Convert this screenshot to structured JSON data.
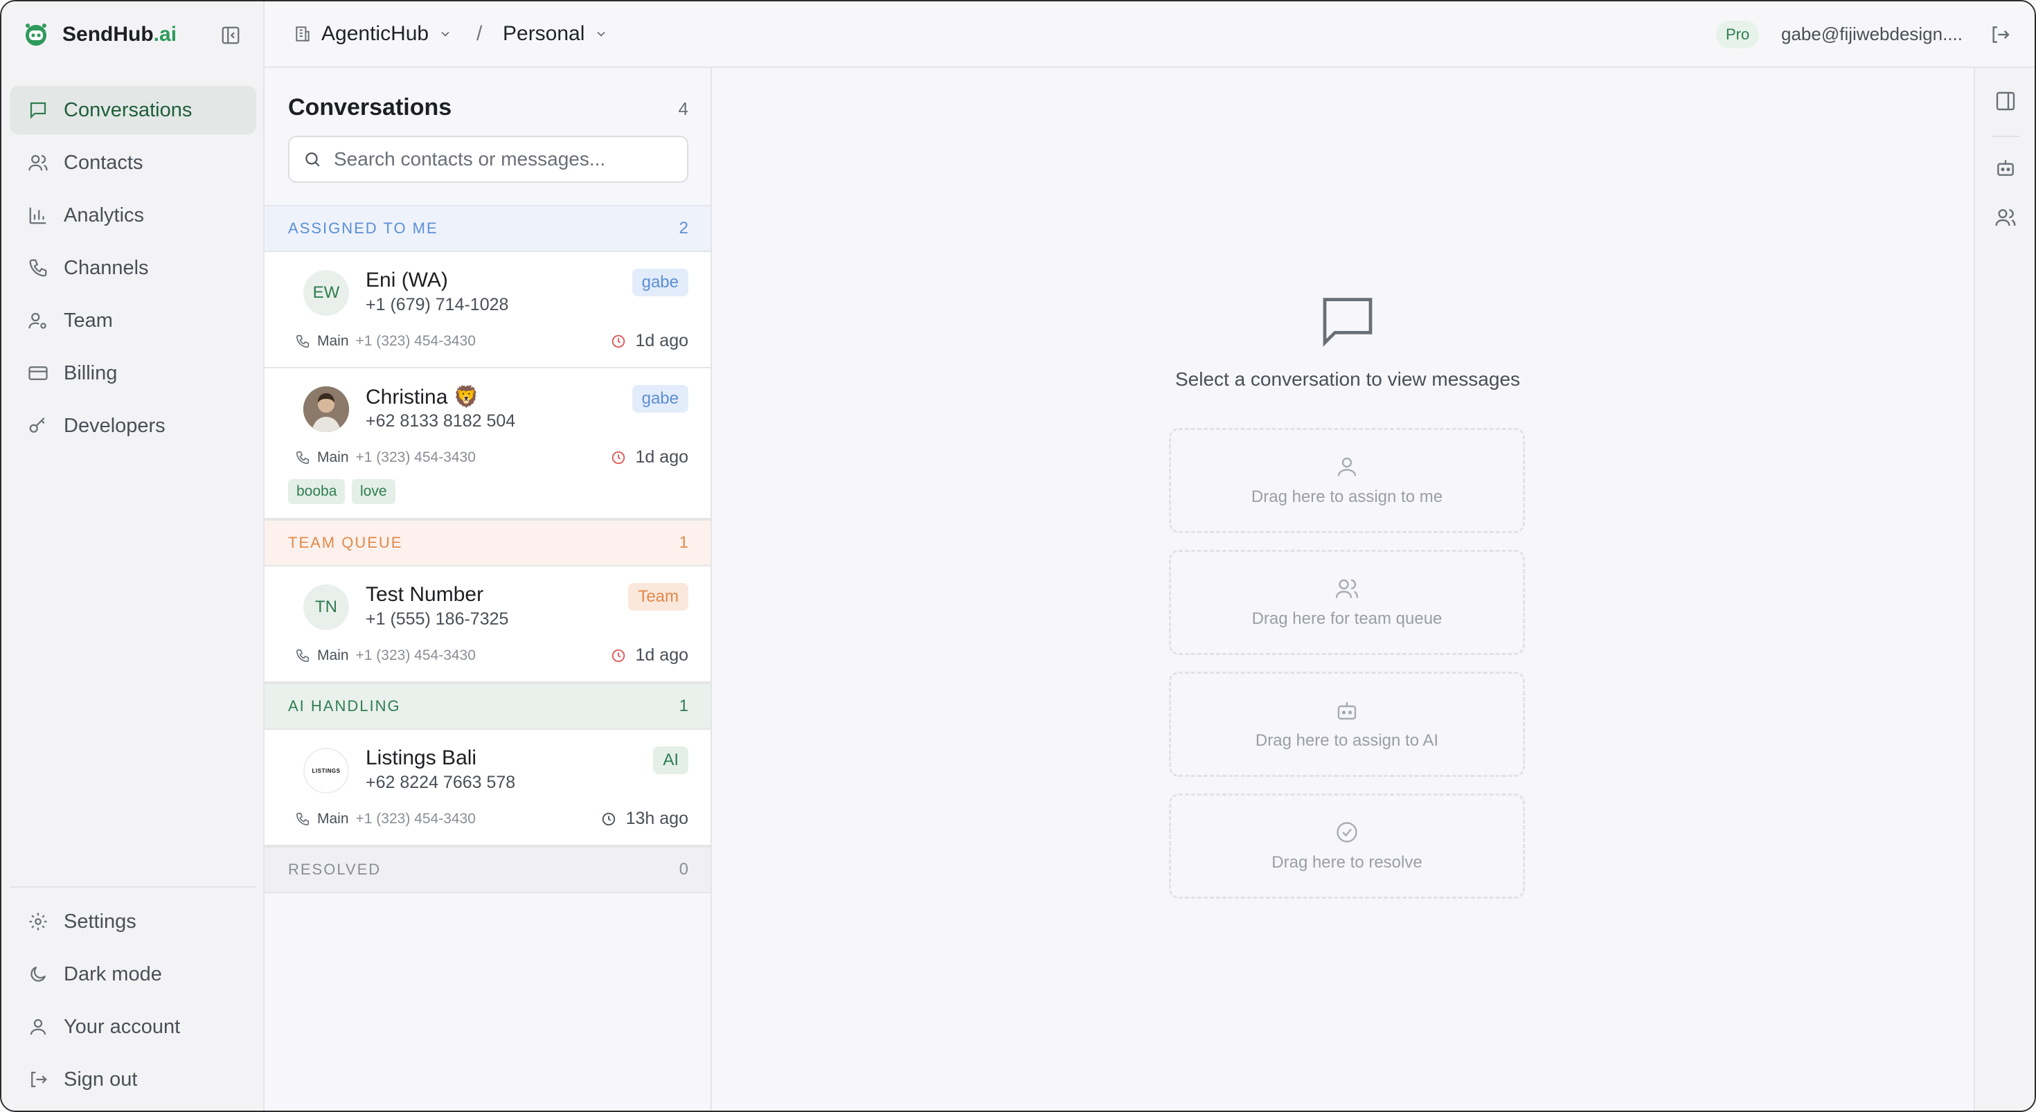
{
  "brand": {
    "name": "SendHub",
    "suffix": ".ai"
  },
  "nav": {
    "items": [
      {
        "label": "Conversations",
        "icon": "chat-icon",
        "active": true
      },
      {
        "label": "Contacts",
        "icon": "users-icon"
      },
      {
        "label": "Analytics",
        "icon": "bar-chart-icon"
      },
      {
        "label": "Channels",
        "icon": "phone-icon"
      },
      {
        "label": "Team",
        "icon": "user-gear-icon"
      },
      {
        "label": "Billing",
        "icon": "credit-card-icon"
      },
      {
        "label": "Developers",
        "icon": "key-icon"
      }
    ],
    "bottom": [
      {
        "label": "Settings",
        "icon": "gear-icon"
      },
      {
        "label": "Dark mode",
        "icon": "moon-icon"
      },
      {
        "label": "Your account",
        "icon": "user-icon"
      },
      {
        "label": "Sign out",
        "icon": "logout-icon"
      }
    ]
  },
  "topbar": {
    "workspace": "AgenticHub",
    "separator": "/",
    "scope": "Personal",
    "plan": "Pro",
    "email": "gabe@fijiwebdesign...."
  },
  "conversations": {
    "title": "Conversations",
    "count": "4",
    "search_placeholder": "Search contacts or messages...",
    "sections": {
      "assigned": {
        "label": "ASSIGNED TO ME",
        "count": "2"
      },
      "team": {
        "label": "TEAM QUEUE",
        "count": "1"
      },
      "ai": {
        "label": "AI HANDLING",
        "count": "1"
      },
      "resolved": {
        "label": "RESOLVED",
        "count": "0"
      }
    },
    "items": [
      {
        "initials": "EW",
        "name": "Eni (WA)",
        "phone": "+1 (679) 714-1028",
        "tag": "gabe",
        "line": "Main",
        "line_number": "+1 (323) 454-3430",
        "ago": "1d ago"
      },
      {
        "initials": "",
        "name": "Christina 🦁",
        "phone": "+62 8133 8182 504",
        "tag": "gabe",
        "line": "Main",
        "line_number": "+1 (323) 454-3430",
        "ago": "1d ago",
        "labels": [
          "booba",
          "love"
        ]
      },
      {
        "initials": "TN",
        "name": "Test Number",
        "phone": "+1 (555) 186-7325",
        "tag": "Team",
        "line": "Main",
        "line_number": "+1 (323) 454-3430",
        "ago": "1d ago"
      },
      {
        "initials": "",
        "logo_text": "LISTINGS",
        "name": "Listings Bali",
        "phone": "+62 8224 7663 578",
        "tag": "AI",
        "line": "Main",
        "line_number": "+1 (323) 454-3430",
        "ago": "13h ago"
      }
    ]
  },
  "main": {
    "empty_text": "Select a conversation to view messages",
    "dropzones": [
      {
        "label": "Drag here to assign to me",
        "icon": "user-icon"
      },
      {
        "label": "Drag here for team queue",
        "icon": "users-icon"
      },
      {
        "label": "Drag here to assign to AI",
        "icon": "robot-icon"
      },
      {
        "label": "Drag here to resolve",
        "icon": "check-circle-icon"
      }
    ]
  },
  "colors": {
    "accent": "#2e9a5b",
    "assigned": "#5b8fd6",
    "team": "#e08a4c",
    "ai": "#2e7d4f"
  }
}
